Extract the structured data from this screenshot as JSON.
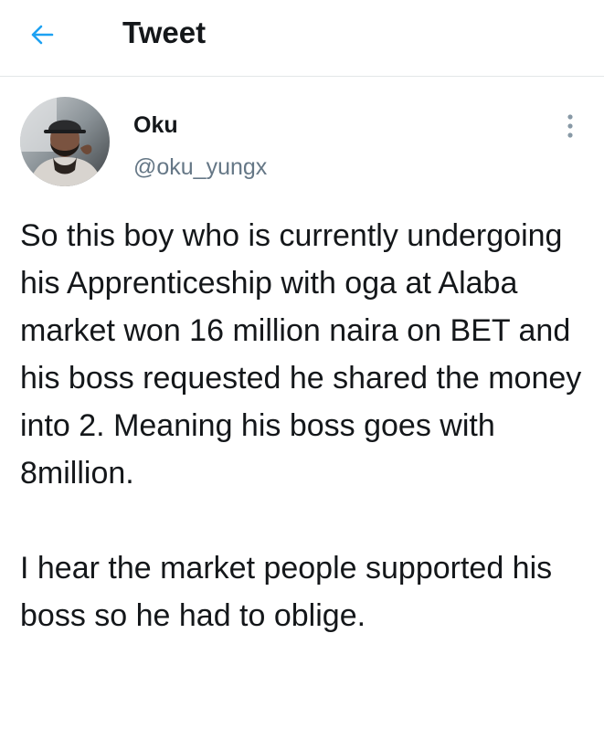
{
  "header": {
    "back_icon": "arrow-left-icon",
    "title": "Tweet"
  },
  "tweet": {
    "author": {
      "name": "Oku",
      "handle": "@oku_yungx",
      "avatar_icon": "profile-photo"
    },
    "more_icon": "more-vertical-icon",
    "paragraphs": [
      "So this boy who is currently undergoing his Apprenticeship with oga at Alaba market won 16 million naira on BET and his boss requested he shared the money into 2. Meaning his boss goes with 8million.",
      "I hear the market people supported his boss so he had to oblige."
    ]
  },
  "colors": {
    "accent": "#1da1f2",
    "text": "#14171a",
    "secondary": "#657786",
    "divider": "#e3e6e8"
  }
}
